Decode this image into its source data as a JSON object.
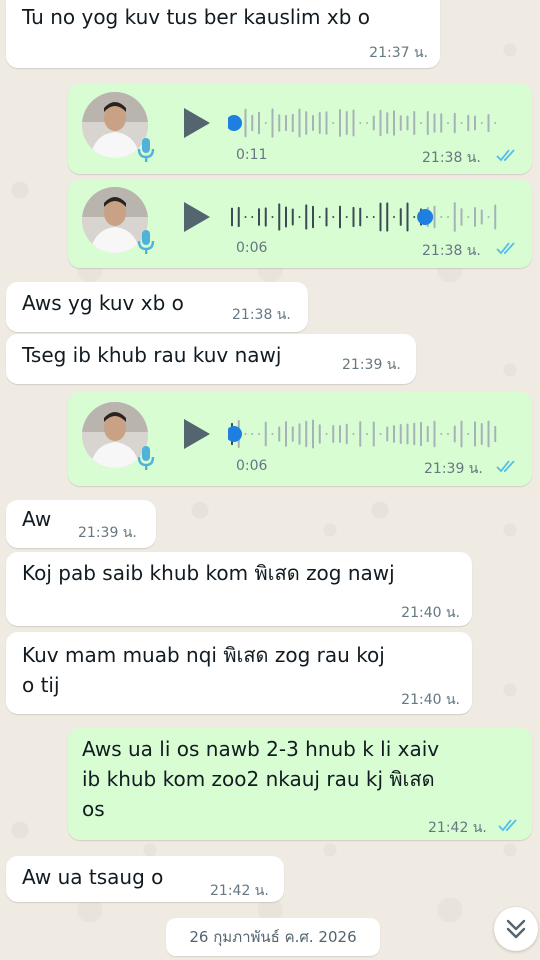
{
  "colors": {
    "incoming_bubble": "#ffffff",
    "outgoing_bubble": "#d9fdd3",
    "read_tick": "#53bdeb",
    "play_icon": "#54656f",
    "mic_icon": "#4fb3d9",
    "progress_dot": "#1e7fe0"
  },
  "messages": [
    {
      "type": "text",
      "dir": "in",
      "text": "Tu no yog kuv tus ber kauslim xb o",
      "time": "21:37 น."
    },
    {
      "type": "voice",
      "dir": "out",
      "duration": "0:11",
      "time": "21:38 น.",
      "status": "read",
      "progress": 0.0
    },
    {
      "type": "voice",
      "dir": "out",
      "duration": "0:06",
      "time": "21:38 น.",
      "status": "read",
      "progress": 0.73
    },
    {
      "type": "text",
      "dir": "in",
      "text": "Aws yg kuv xb o",
      "time": "21:38 น."
    },
    {
      "type": "text",
      "dir": "in",
      "text": "Tseg ib khub rau kuv nawj",
      "time": "21:39 น."
    },
    {
      "type": "voice",
      "dir": "out",
      "duration": "0:06",
      "time": "21:39 น.",
      "status": "read",
      "progress": 0.0
    },
    {
      "type": "text",
      "dir": "in",
      "text": "Aw",
      "time": "21:39 น."
    },
    {
      "type": "text",
      "dir": "in",
      "text": "Koj pab saib khub kom พิเสด zog nawj",
      "time": "21:40 น."
    },
    {
      "type": "text",
      "dir": "in",
      "text": "Kuv mam muab nqi พิเสด zog rau koj\no tij",
      "time": "21:40 น."
    },
    {
      "type": "text",
      "dir": "out",
      "text": "Aws ua li os nawb 2-3 hnub k li xaiv\nib khub kom zoo2 nkauj rau kj พิเสด\nos",
      "time": "21:42 น.",
      "status": "read"
    },
    {
      "type": "text",
      "dir": "in",
      "text": "Aw ua tsaug o",
      "time": "21:42 น."
    }
  ],
  "date_chip": "26 กุมภาพันธ์ ค.ศ. 2026",
  "icons": {
    "play": "play-icon",
    "mic": "mic-icon",
    "ticks": "double-check-icon",
    "scroll": "chevron-double-down-icon"
  }
}
